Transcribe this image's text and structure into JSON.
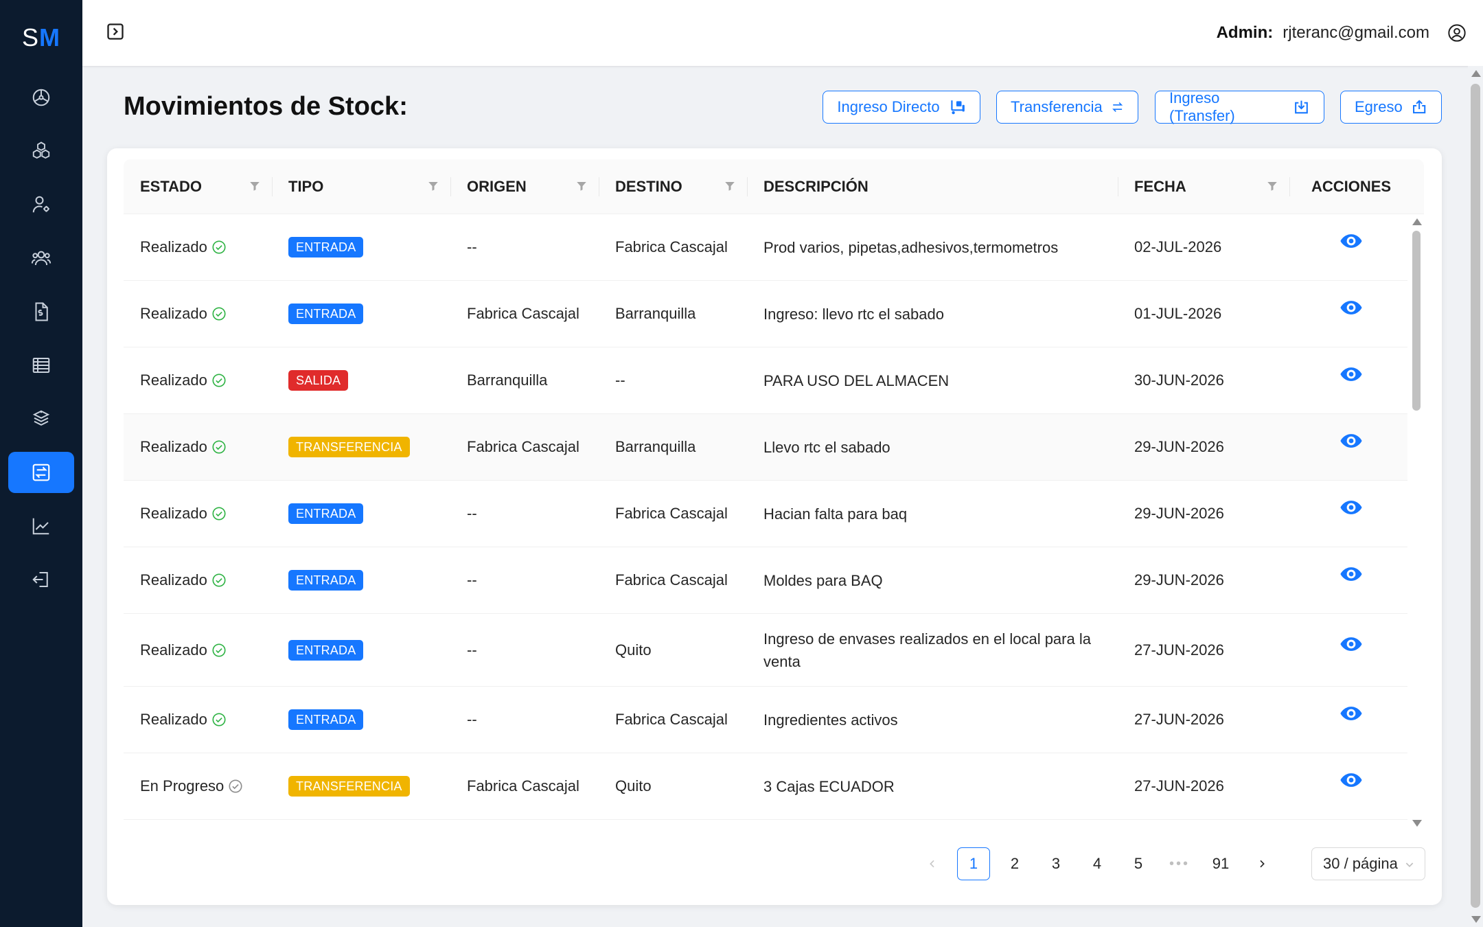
{
  "app": {
    "logo_s": "S",
    "logo_m": "M",
    "brand_color": "#1677ff",
    "sidebar_bg": "#0c1b2e"
  },
  "sidebar": {
    "items": [
      {
        "icon": "dashboard-icon",
        "active": false
      },
      {
        "icon": "products-icon",
        "active": false
      },
      {
        "icon": "user-settings-icon",
        "active": false
      },
      {
        "icon": "users-icon",
        "active": false
      },
      {
        "icon": "invoice-icon",
        "active": false
      },
      {
        "icon": "list-icon",
        "active": false
      },
      {
        "icon": "inventory-icon",
        "active": false
      },
      {
        "icon": "stock-movements-icon",
        "active": true
      },
      {
        "icon": "reports-chart-icon",
        "active": false
      },
      {
        "icon": "logout-icon",
        "active": false
      }
    ]
  },
  "header": {
    "admin_label": "Admin:",
    "admin_email": "rjteranc@gmail.com"
  },
  "page": {
    "title": "Movimientos de Stock:",
    "actions": {
      "ingreso_directo": "Ingreso Directo",
      "transferencia": "Transferencia",
      "ingreso_transfer": "Ingreso (Transfer)",
      "egreso": "Egreso"
    }
  },
  "table": {
    "columns": {
      "estado": "ESTADO",
      "tipo": "TIPO",
      "origen": "ORIGEN",
      "destino": "DESTINO",
      "descripcion": "DESCRIPCIÓN",
      "fecha": "FECHA",
      "acciones": "ACCIONES"
    },
    "tag_colors": {
      "ENTRADA": "#1677ff",
      "SALIDA": "#e02b2b",
      "TRANSFERENCIA": "#f0b400"
    },
    "rows": [
      {
        "estado": "Realizado",
        "done": true,
        "tipo": "ENTRADA",
        "origen": "--",
        "destino": "Fabrica Cascajal",
        "descripcion": "Prod varios, pipetas,adhesivos,termometros",
        "fecha": "02-JUL-2026"
      },
      {
        "estado": "Realizado",
        "done": true,
        "tipo": "ENTRADA",
        "origen": "Fabrica Cascajal",
        "destino": "Barranquilla",
        "descripcion": "Ingreso: llevo rtc el sabado",
        "fecha": "01-JUL-2026"
      },
      {
        "estado": "Realizado",
        "done": true,
        "tipo": "SALIDA",
        "origen": "Barranquilla",
        "destino": "--",
        "descripcion": "PARA USO DEL ALMACEN",
        "fecha": "30-JUN-2026"
      },
      {
        "estado": "Realizado",
        "done": true,
        "tipo": "TRANSFERENCIA",
        "origen": "Fabrica Cascajal",
        "destino": "Barranquilla",
        "descripcion": "Llevo rtc el sabado",
        "fecha": "29-JUN-2026"
      },
      {
        "estado": "Realizado",
        "done": true,
        "tipo": "ENTRADA",
        "origen": "--",
        "destino": "Fabrica Cascajal",
        "descripcion": "Hacian falta para baq",
        "fecha": "29-JUN-2026"
      },
      {
        "estado": "Realizado",
        "done": true,
        "tipo": "ENTRADA",
        "origen": "--",
        "destino": "Fabrica Cascajal",
        "descripcion": "Moldes para BAQ",
        "fecha": "29-JUN-2026"
      },
      {
        "estado": "Realizado",
        "done": true,
        "tipo": "ENTRADA",
        "origen": "--",
        "destino": "Quito",
        "descripcion": "Ingreso de envases realizados en el local para la venta",
        "fecha": "27-JUN-2026"
      },
      {
        "estado": "Realizado",
        "done": true,
        "tipo": "ENTRADA",
        "origen": "--",
        "destino": "Fabrica Cascajal",
        "descripcion": "Ingredientes activos",
        "fecha": "27-JUN-2026"
      },
      {
        "estado": "En Progreso",
        "done": false,
        "tipo": "TRANSFERENCIA",
        "origen": "Fabrica Cascajal",
        "destino": "Quito",
        "descripcion": "3 Cajas ECUADOR",
        "fecha": "27-JUN-2026"
      }
    ]
  },
  "pagination": {
    "pages": [
      "1",
      "2",
      "3",
      "4",
      "5"
    ],
    "current": "1",
    "ellipsis": "•••",
    "last": "91",
    "page_size": "30 / página"
  }
}
